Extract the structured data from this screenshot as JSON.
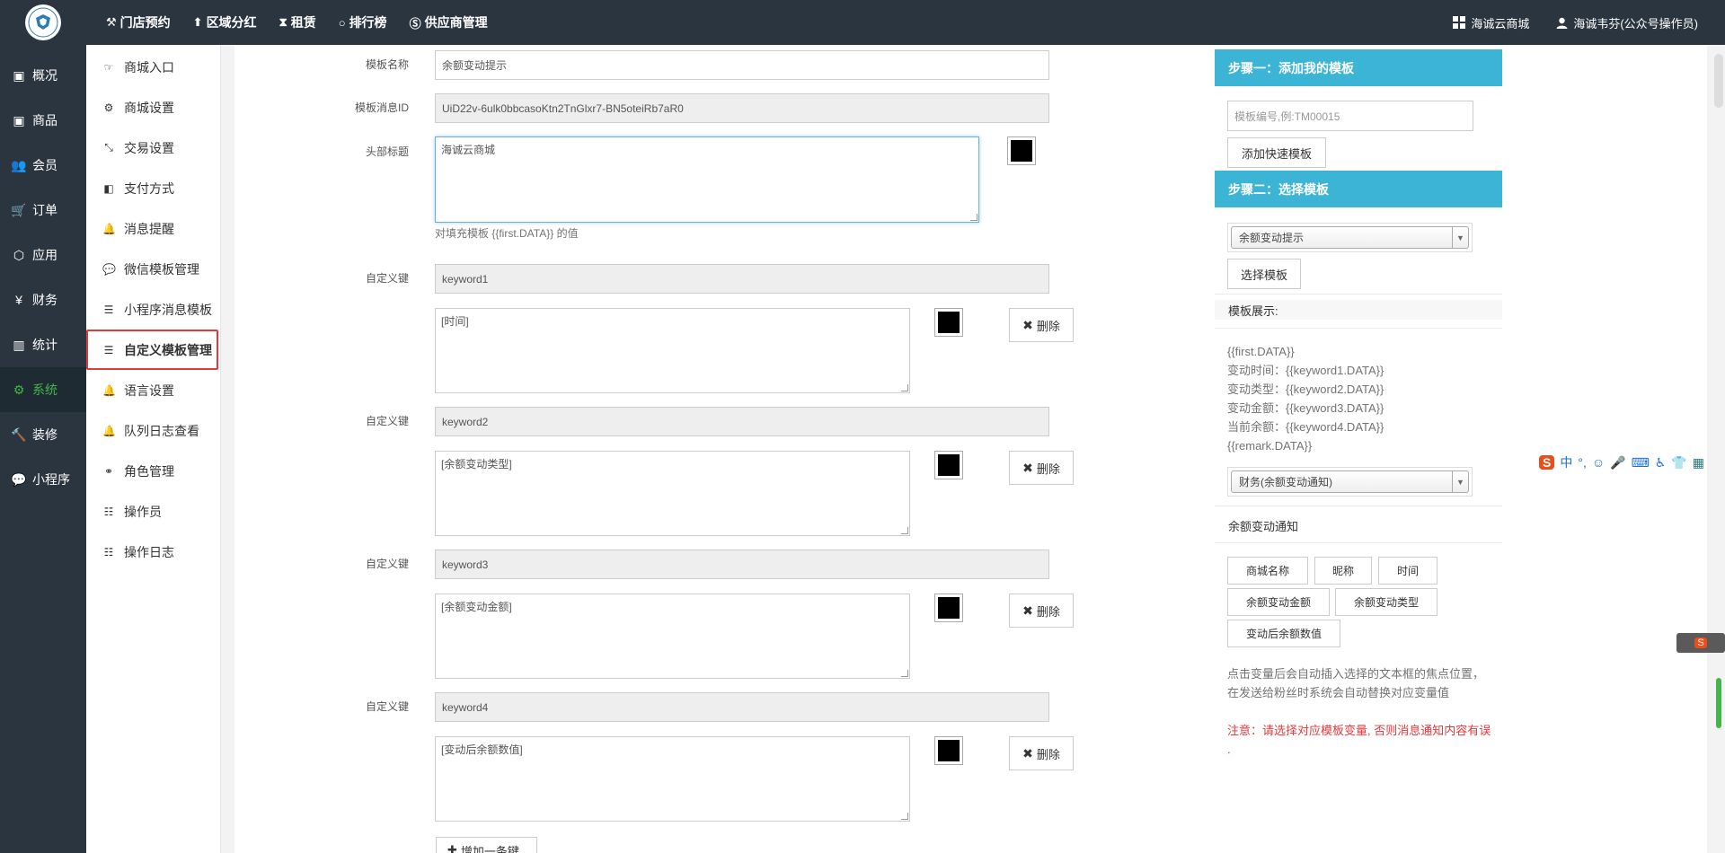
{
  "topbar": {
    "nav": [
      {
        "label": "门店预约",
        "icon": "hammer-icon",
        "glyph": "⚒"
      },
      {
        "label": "区域分红",
        "icon": "shovel-icon",
        "glyph": "⬆"
      },
      {
        "label": "租赁",
        "icon": "hourglass-icon",
        "glyph": "⧗"
      },
      {
        "label": "排行榜",
        "icon": "circle-icon",
        "glyph": "○"
      },
      {
        "label": "供应商管理",
        "icon": "skype-icon",
        "glyph": "Ⓢ"
      }
    ],
    "shop_label": "海诚云商城",
    "user_label": "海诚韦芬(公众号操作员)"
  },
  "sidebar": {
    "items": [
      {
        "label": "概况",
        "glyph": "▣"
      },
      {
        "label": "商品",
        "glyph": "▣"
      },
      {
        "label": "会员",
        "glyph": "👥"
      },
      {
        "label": "订单",
        "glyph": "🛒"
      },
      {
        "label": "应用",
        "glyph": "⬡"
      },
      {
        "label": "财务",
        "glyph": "¥"
      },
      {
        "label": "统计",
        "glyph": "▥"
      },
      {
        "label": "系统",
        "glyph": "⚙"
      },
      {
        "label": "装修",
        "glyph": "🔨"
      },
      {
        "label": "小程序",
        "glyph": "💬"
      }
    ]
  },
  "submenu": {
    "items": [
      {
        "label": "商城入口",
        "glyph": "☞"
      },
      {
        "label": "商城设置",
        "glyph": "⚙"
      },
      {
        "label": "交易设置",
        "glyph": "⤡"
      },
      {
        "label": "支付方式",
        "glyph": "◧"
      },
      {
        "label": "消息提醒",
        "glyph": "🔔"
      },
      {
        "label": "微信模板管理",
        "glyph": "💬"
      },
      {
        "label": "小程序消息模板",
        "glyph": "☰"
      },
      {
        "label": "自定义模板管理",
        "glyph": "☰"
      },
      {
        "label": "语言设置",
        "glyph": "🔔"
      },
      {
        "label": "队列日志查看",
        "glyph": "🔔"
      },
      {
        "label": "角色管理",
        "glyph": "⚭"
      },
      {
        "label": "操作员",
        "glyph": "☷"
      },
      {
        "label": "操作日志",
        "glyph": "☷"
      }
    ]
  },
  "form": {
    "template_name_label": "模板名称",
    "template_name_value": "余额变动提示",
    "template_id_label": "模板消息ID",
    "template_id_value": "UiD22v-6ulk0bbcasoKtn2TnGlxr7-BN5oteiRb7aR0",
    "header_title_label": "头部标题",
    "header_title_value": "海诚云商城",
    "header_help": "对填充模板 {{first.DATA}} 的值",
    "custom_key_label": "自定义键",
    "keys": [
      {
        "key": "keyword1",
        "value": "[时间]"
      },
      {
        "key": "keyword2",
        "value": "[余额变动类型]"
      },
      {
        "key": "keyword3",
        "value": "[余额变动金额]"
      },
      {
        "key": "keyword4",
        "value": "[变动后余额数值]"
      }
    ],
    "delete_label": "删除",
    "add_key_label": "增加一条键"
  },
  "right_panel": {
    "step1_title": "步骤一：添加我的模板",
    "template_no_placeholder": "模板编号,例:TM00015",
    "add_quick_template": "添加快速模板",
    "step2_title": "步骤二：选择模板",
    "selected_template": "余额变动提示",
    "select_template_btn": "选择模板",
    "template_preview_label": "模板展示:",
    "template_lines": [
      "{{first.DATA}}",
      "变动时间：{{keyword1.DATA}}",
      "变动类型：{{keyword2.DATA}}",
      "变动金额：{{keyword3.DATA}}",
      "当前余额：{{keyword4.DATA}}",
      "{{remark.DATA}}"
    ],
    "selected_notify": "财务(余额变动通知)",
    "notify_title": "余额变动通知",
    "variables": [
      "商城名称",
      "昵称",
      "时间",
      "余额变动金额",
      "余额变动类型",
      "变动后余额数值"
    ],
    "tip": "点击变量后会自动插入选择的文本框的焦点位置，在发送给粉丝时系统会自动替换对应变量值",
    "warning": "注意：请选择对应模板变量, 否则消息通知内容有误 ."
  },
  "ime": {
    "logo": "S",
    "mode": "中",
    "punct": "°,",
    "mini_logo": "S"
  }
}
